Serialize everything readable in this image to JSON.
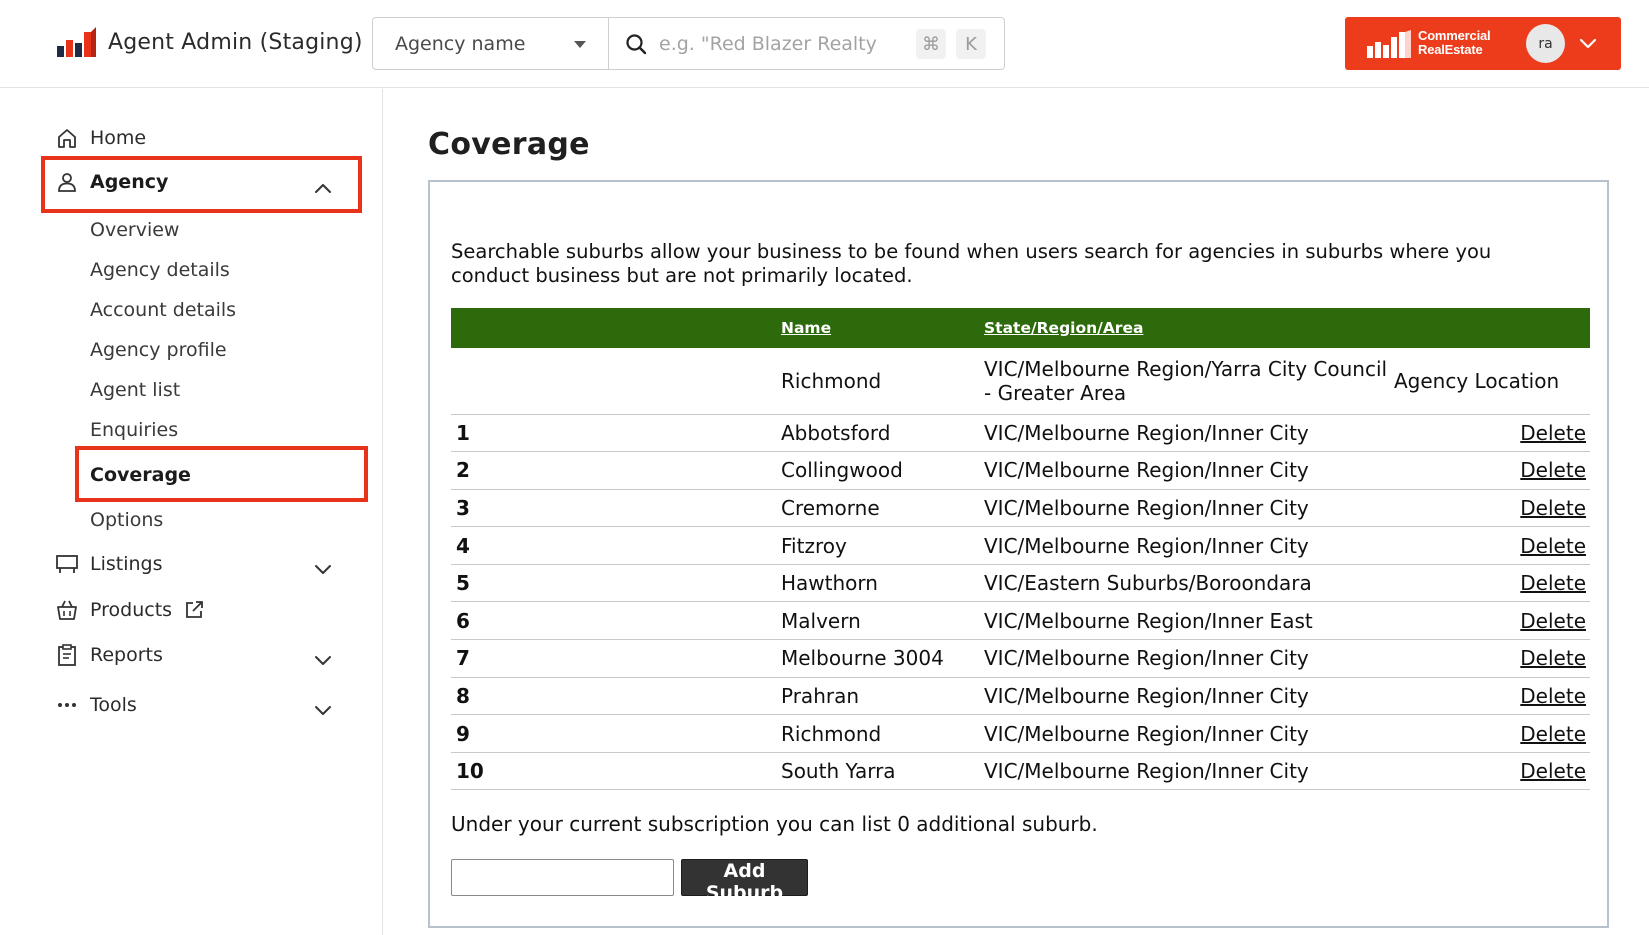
{
  "header": {
    "app_title": "Agent Admin (Staging)",
    "search_type": "Agency name",
    "search_placeholder": "e.g. \"Red Blazer Realty",
    "shortcut_modifier": "⌘",
    "shortcut_key": "K",
    "brand_line1": "Commercial",
    "brand_line2": "RealEstate",
    "avatar_initials": "ra",
    "accent_color": "#ec3c1b"
  },
  "sidebar": {
    "home": "Home",
    "agency": "Agency",
    "agency_sub": [
      "Overview",
      "Agency details",
      "Account details",
      "Agency profile",
      "Agent list",
      "Enquiries",
      "Coverage",
      "Options"
    ],
    "listings": "Listings",
    "products": "Products",
    "reports": "Reports",
    "tools": "Tools",
    "highlight_color": "#e8331a"
  },
  "main": {
    "title": "Coverage",
    "intro": "Searchable suburbs allow your business to be found when users search for agencies in suburbs where you conduct business but are not primarily located.",
    "table": {
      "header_color": "#2d6a0b",
      "col_name": "Name",
      "col_state": "State/Region/Area",
      "primary": {
        "name": "Richmond",
        "state": "VIC/Melbourne Region/Yarra City Council - Greater Area",
        "label": "Agency Location"
      },
      "rows": [
        {
          "num": "1",
          "name": "Abbotsford",
          "state": "VIC/Melbourne Region/Inner City",
          "action": "Delete"
        },
        {
          "num": "2",
          "name": "Collingwood",
          "state": "VIC/Melbourne Region/Inner City",
          "action": "Delete"
        },
        {
          "num": "3",
          "name": "Cremorne",
          "state": "VIC/Melbourne Region/Inner City",
          "action": "Delete"
        },
        {
          "num": "4",
          "name": "Fitzroy",
          "state": "VIC/Melbourne Region/Inner City",
          "action": "Delete"
        },
        {
          "num": "5",
          "name": "Hawthorn",
          "state": "VIC/Eastern Suburbs/Boroondara",
          "action": "Delete"
        },
        {
          "num": "6",
          "name": "Malvern",
          "state": "VIC/Melbourne Region/Inner East",
          "action": "Delete"
        },
        {
          "num": "7",
          "name": "Melbourne 3004",
          "state": "VIC/Melbourne Region/Inner City",
          "action": "Delete"
        },
        {
          "num": "8",
          "name": "Prahran",
          "state": "VIC/Melbourne Region/Inner City",
          "action": "Delete"
        },
        {
          "num": "9",
          "name": "Richmond",
          "state": "VIC/Melbourne Region/Inner City",
          "action": "Delete"
        },
        {
          "num": "10",
          "name": "South Yarra",
          "state": "VIC/Melbourne Region/Inner City",
          "action": "Delete"
        }
      ]
    },
    "subscription_note": "Under your current subscription you can list 0 additional suburb.",
    "add_input_value": "",
    "add_button": "Add Suburb"
  }
}
